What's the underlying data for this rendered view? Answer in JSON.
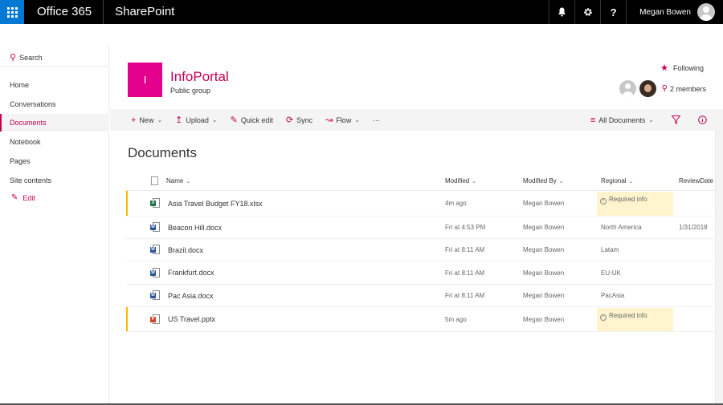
{
  "suite": {
    "brand": "Office 365",
    "app": "SharePoint",
    "user": "Megan Bowen",
    "help_label": "?"
  },
  "nav": {
    "search_label": "Search",
    "items": [
      {
        "label": "Home"
      },
      {
        "label": "Conversations"
      },
      {
        "label": "Documents"
      },
      {
        "label": "Notebook"
      },
      {
        "label": "Pages"
      },
      {
        "label": "Site contents"
      }
    ],
    "selected": "Documents",
    "edit_label": "Edit"
  },
  "site": {
    "logo_letter": "I",
    "title": "InfoPortal",
    "subtitle": "Public group",
    "following_label": "Following",
    "members_label": "2 members"
  },
  "commands": {
    "new": "New",
    "upload": "Upload",
    "quick_edit": "Quick edit",
    "sync": "Sync",
    "flow": "Flow",
    "more": "···",
    "view": "All Documents"
  },
  "library": {
    "title": "Documents",
    "columns": {
      "name": "Name",
      "modified": "Modified",
      "modified_by": "Modified By",
      "regional": "Regional",
      "review_date": "ReviewDate"
    },
    "required_label": "Required info",
    "rows": [
      {
        "name": "Asia Travel Budget FY18.xlsx",
        "type": "xlsx",
        "modified": "4m ago",
        "modified_by": "Megan Bowen",
        "regional": "",
        "review_date": "",
        "required": true
      },
      {
        "name": "Beacon Hill.docx",
        "type": "docx",
        "modified": "Fri at 4:53 PM",
        "modified_by": "Megan Bowen",
        "regional": "North America",
        "review_date": "1/31/2018",
        "required": false
      },
      {
        "name": "Brazil.docx",
        "type": "docx",
        "modified": "Fri at 8:11 AM",
        "modified_by": "Megan Bowen",
        "regional": "Latam",
        "review_date": "",
        "required": false
      },
      {
        "name": "Frankfurt.docx",
        "type": "docx",
        "modified": "Fri at 8:11 AM",
        "modified_by": "Megan Bowen",
        "regional": "EU-UK",
        "review_date": "",
        "required": false
      },
      {
        "name": "Pac Asia.docx",
        "type": "docx",
        "modified": "Fri at 8:11 AM",
        "modified_by": "Megan Bowen",
        "regional": "PacAsia",
        "review_date": "",
        "required": false
      },
      {
        "name": "US Travel.pptx",
        "type": "pptx",
        "modified": "5m ago",
        "modified_by": "Megan Bowen",
        "regional": "",
        "review_date": "",
        "required": true
      }
    ]
  },
  "icons": {
    "waffle": "app-launcher-icon",
    "bell": "notifications-icon",
    "gear": "settings-icon",
    "search": "search-icon",
    "edit": "pencil-icon",
    "star": "star-icon",
    "person": "person-icon",
    "plus": "plus-icon",
    "upload": "upload-icon",
    "sync": "sync-icon",
    "flow": "flow-icon",
    "filter": "filter-icon",
    "info": "info-icon",
    "view": "view-list-icon"
  },
  "colors": {
    "accent": "#c30052",
    "logo": "#e3008c",
    "suite_bar": "#000000",
    "waffle": "#0078d4",
    "required_bg": "#fff4ce",
    "required_flag": "#ffb900"
  }
}
